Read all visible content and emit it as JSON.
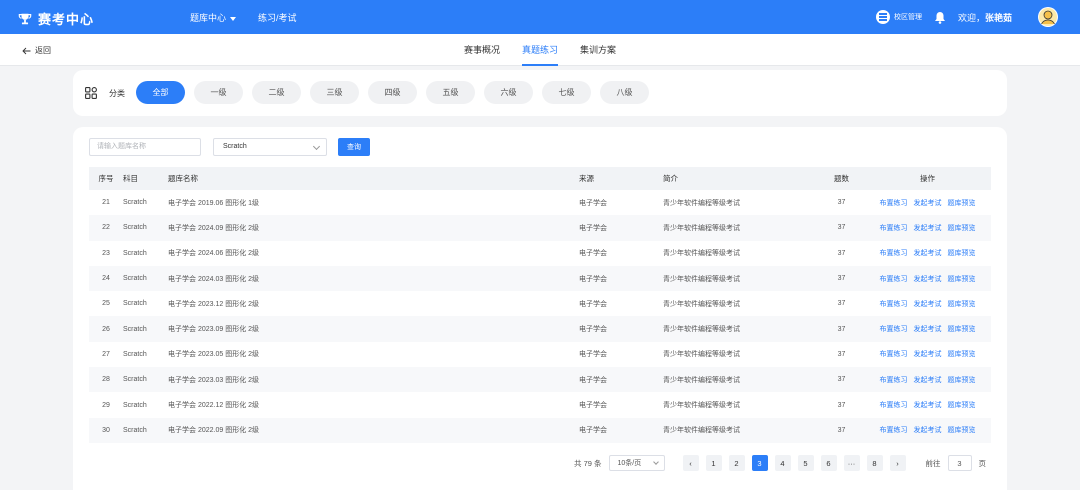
{
  "header": {
    "logo_text": "赛考中心",
    "nav": [
      "题库中心",
      "练习/考试"
    ],
    "campus_label": "校区管理",
    "welcome_prefix": "欢迎，",
    "username": "张艳茹"
  },
  "subnav": {
    "back_label": "返回",
    "tabs": [
      "赛事概况",
      "真题练习",
      "集训方案"
    ],
    "active_tab": "真题练习"
  },
  "category": {
    "label": "分类",
    "chips": [
      "全部",
      "一级",
      "二级",
      "三级",
      "四级",
      "五级",
      "六级",
      "七级",
      "八级"
    ],
    "active": "全部"
  },
  "filters": {
    "search_placeholder": "请输入题库名称",
    "subject_value": "Scratch",
    "query_label": "查询"
  },
  "table": {
    "headers": [
      "序号",
      "科目",
      "题库名称",
      "来源",
      "简介",
      "题数",
      "操作"
    ],
    "rows": [
      {
        "no": "21",
        "subject": "Scratch",
        "name": "电子学会 2019.06 图形化 1级",
        "source": "电子学会",
        "desc": "青少年软件编程等级考试",
        "count": "37"
      },
      {
        "no": "22",
        "subject": "Scratch",
        "name": "电子学会 2024.09 图形化 2级",
        "source": "电子学会",
        "desc": "青少年软件编程等级考试",
        "count": "37"
      },
      {
        "no": "23",
        "subject": "Scratch",
        "name": "电子学会 2024.06 图形化 2级",
        "source": "电子学会",
        "desc": "青少年软件编程等级考试",
        "count": "37"
      },
      {
        "no": "24",
        "subject": "Scratch",
        "name": "电子学会 2024.03 图形化 2级",
        "source": "电子学会",
        "desc": "青少年软件编程等级考试",
        "count": "37"
      },
      {
        "no": "25",
        "subject": "Scratch",
        "name": "电子学会 2023.12 图形化 2级",
        "source": "电子学会",
        "desc": "青少年软件编程等级考试",
        "count": "37"
      },
      {
        "no": "26",
        "subject": "Scratch",
        "name": "电子学会 2023.09 图形化 2级",
        "source": "电子学会",
        "desc": "青少年软件编程等级考试",
        "count": "37"
      },
      {
        "no": "27",
        "subject": "Scratch",
        "name": "电子学会 2023.05 图形化 2级",
        "source": "电子学会",
        "desc": "青少年软件编程等级考试",
        "count": "37"
      },
      {
        "no": "28",
        "subject": "Scratch",
        "name": "电子学会 2023.03 图形化 2级",
        "source": "电子学会",
        "desc": "青少年软件编程等级考试",
        "count": "37"
      },
      {
        "no": "29",
        "subject": "Scratch",
        "name": "电子学会 2022.12 图形化 2级",
        "source": "电子学会",
        "desc": "青少年软件编程等级考试",
        "count": "37"
      },
      {
        "no": "30",
        "subject": "Scratch",
        "name": "电子学会 2022.09 图形化 2级",
        "source": "电子学会",
        "desc": "青少年软件编程等级考试",
        "count": "37"
      }
    ],
    "actions": [
      "布置练习",
      "发起考试",
      "题库预览"
    ]
  },
  "pagination": {
    "total_text": "共 79 条",
    "page_size": "10条/页",
    "pages": [
      "1",
      "2",
      "3",
      "4",
      "5",
      "6",
      "···",
      "8"
    ],
    "current": "3",
    "prev": "‹",
    "next": "›",
    "jump_prefix": "前往",
    "jump_value": "3",
    "jump_suffix": "页"
  },
  "colors": {
    "primary": "#2c7ef8",
    "background": "#f3f4f6"
  },
  "icons": [
    "trophy-icon",
    "campus-menu-icon",
    "bell-icon",
    "avatar-icon",
    "back-arrow-icon",
    "category-grid-icon",
    "chevron-down-icon"
  ]
}
